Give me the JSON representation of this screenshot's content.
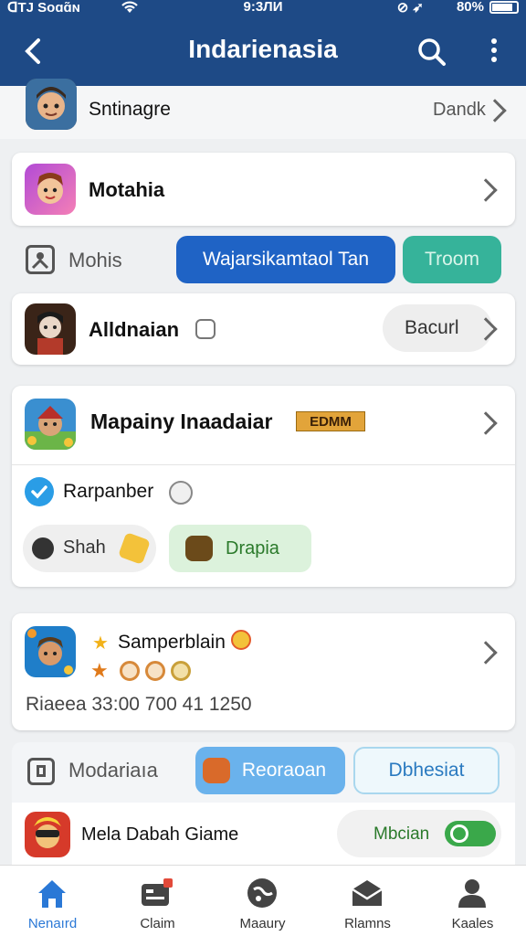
{
  "status_bar": {
    "carrier": "ᗡΤЈ Soɑɑ̃ɴ",
    "time": "9:3ЛИ",
    "battery": "80%"
  },
  "app_bar": {
    "title": "Indarienasia"
  },
  "partial_row": {
    "title": "Sntinagre",
    "action": "Dandk"
  },
  "cards": [
    {
      "title": "Motahia"
    },
    {
      "title": "Alldnaian",
      "action": "Bacurl"
    },
    {
      "title": "Mapainy Inaadaiar",
      "badge": "EDMM",
      "account": "Rarpanber",
      "chips": [
        "Shah",
        "Drapia"
      ]
    },
    {
      "title": "Samperblain",
      "detail": "Riaeea 33:00 700 41 1250"
    },
    {
      "title": "Mela Dabah Giame",
      "action": "Mbcian"
    }
  ],
  "section1": {
    "label": "Mohis",
    "primary_button": "Wajarsikamtaol Tan",
    "secondary_button": "Troom"
  },
  "section2": {
    "label": "Modariaıa",
    "primary_button": "Reoraoan",
    "secondary_button": "Dbhesiat"
  },
  "bottom_nav": [
    {
      "label": "Nenaırd",
      "icon": "home-icon"
    },
    {
      "label": "Claim",
      "icon": "ticket-icon"
    },
    {
      "label": "Maaury",
      "icon": "globe-icon"
    },
    {
      "label": "Rlamns",
      "icon": "mail-icon"
    },
    {
      "label": "Kaales",
      "icon": "person-icon"
    }
  ],
  "colors": {
    "app_bar": "#1e4a86",
    "primary": "#1f63c5",
    "teal": "#36b39a",
    "nav_active": "#2a78d6"
  }
}
